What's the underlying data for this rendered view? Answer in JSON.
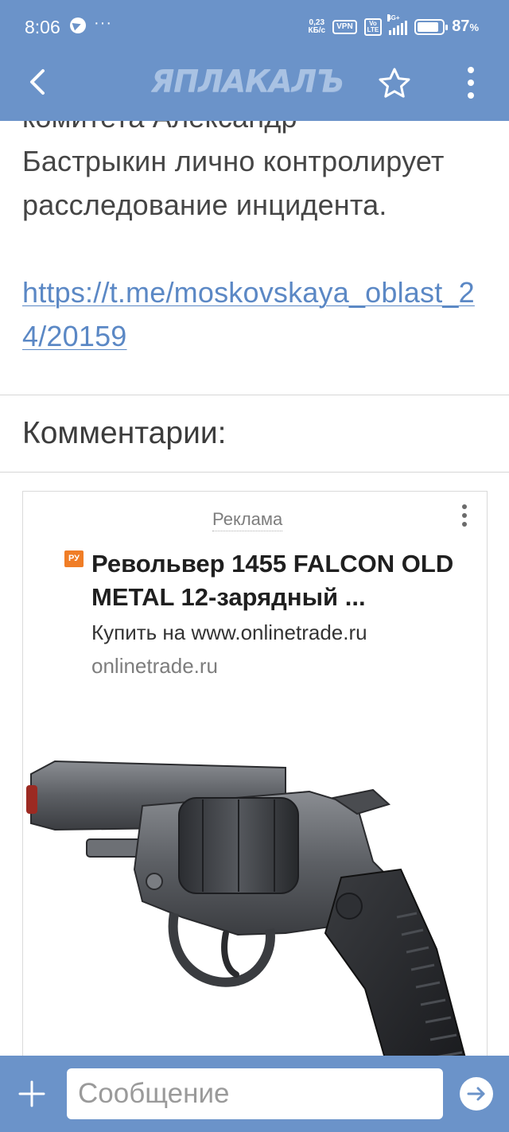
{
  "status_bar": {
    "time": "8:06",
    "more": "···",
    "speed_value": "0,23",
    "speed_unit": "КБ/с",
    "vpn": "VPN",
    "volte_top": "Vo",
    "volte_bottom": "LTE",
    "network": "4G+",
    "battery_percent": "87",
    "battery_suffix": "%",
    "battery_level": 0.87
  },
  "app_bar": {
    "logo_text": "ЯПЛАКАЛЪ"
  },
  "article": {
    "partial_top": "комитета Александр",
    "text": "Бастрыкин лично контролирует расследование инцидента.",
    "link": "https://t.me/moskovskaya_oblast_24/20159"
  },
  "comments": {
    "heading": "Комментарии:"
  },
  "ad": {
    "label": "Реклама",
    "badge": "РУ",
    "title": "Револьвер 1455 FALCON OLD METAL 12-зарядный ...",
    "description": "Купить на www.onlinetrade.ru",
    "domain": "onlinetrade.ru"
  },
  "composer": {
    "placeholder": "Сообщение"
  },
  "colors": {
    "brand_blue": "#6b93c9",
    "link_blue": "#5b88c5",
    "badge_orange": "#f07d26"
  },
  "icons": [
    "back-arrow-icon",
    "star-icon",
    "more-vertical-icon",
    "telegram-icon",
    "plus-icon",
    "send-arrow-icon",
    "revolver-image"
  ]
}
